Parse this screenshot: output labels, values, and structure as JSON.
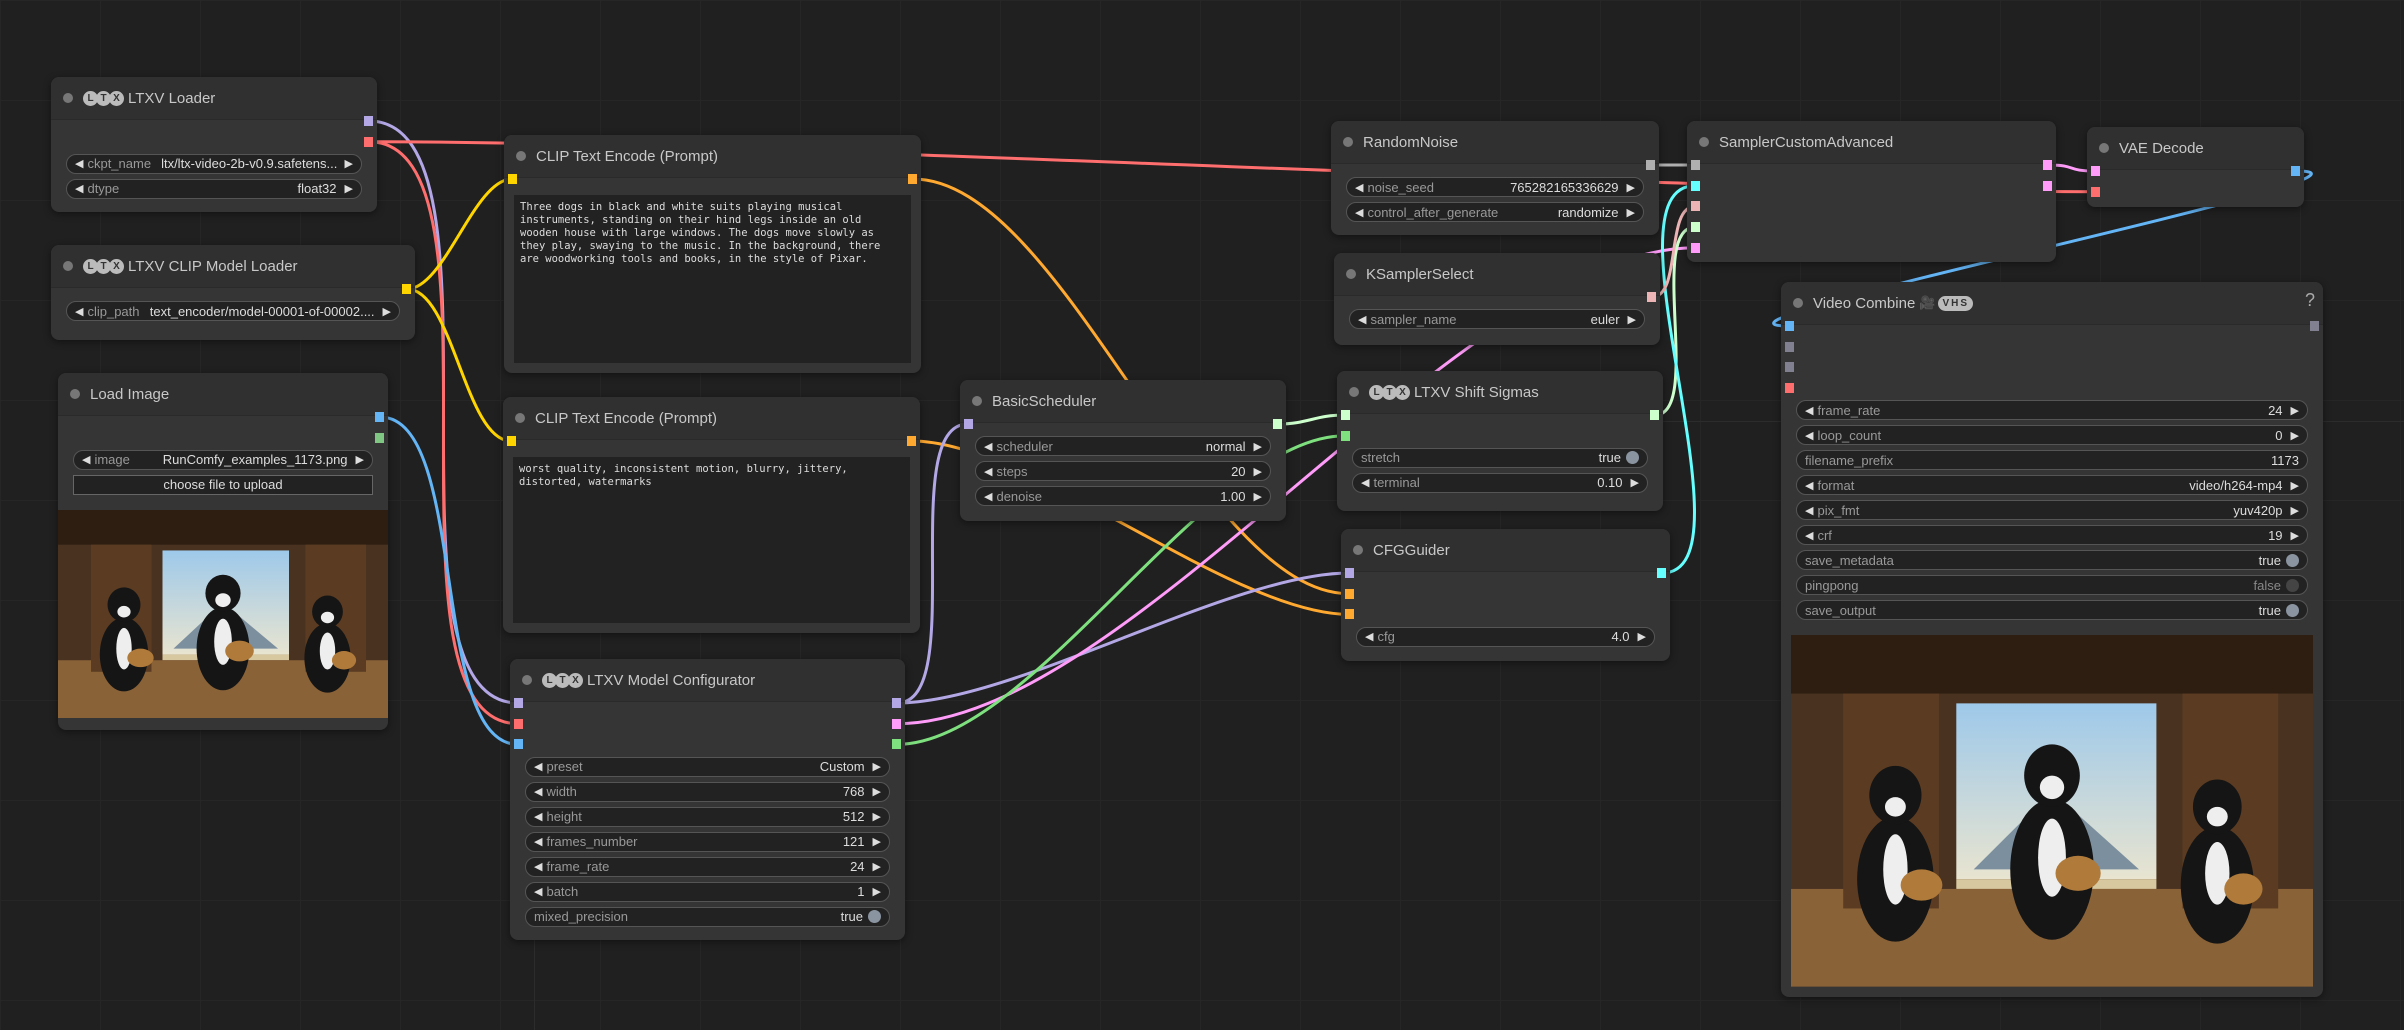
{
  "colors": {
    "model": "#b4a7e6",
    "vae": "#ff6e6e",
    "clip": "#ffd500",
    "image": "#64b5f6",
    "mask": "#81c784",
    "conditioning": "#ffa931",
    "latent": "#ff9cf9",
    "latent2": "#7ee07e",
    "sigmas": "#cdffcd",
    "noise": "#b0b0b0",
    "guider": "#66ffff",
    "sampler": "#ecb4b4",
    "grey": "#808090"
  },
  "nodes": {
    "loader": {
      "title": "LTXV Loader",
      "ltx_badge": "LTX",
      "outputs": [
        "model",
        "vae"
      ],
      "inputs": [],
      "widgets": [
        {
          "type": "combo",
          "label": "ckpt_name",
          "value": "ltx/ltx-video-2b-v0.9.safetens..."
        },
        {
          "type": "combo",
          "label": "dtype",
          "value": "float32"
        }
      ]
    },
    "clip_loader": {
      "title": "LTXV CLIP Model Loader",
      "ltx_badge": "LTX",
      "outputs": [
        "clip"
      ],
      "inputs": [],
      "widgets": [
        {
          "type": "combo",
          "label": "clip_path",
          "value": "text_encoder/model-00001-of-00002...."
        }
      ]
    },
    "load_image": {
      "title": "Load Image",
      "outputs": [
        "image",
        "mask"
      ],
      "inputs": [],
      "widgets": [
        {
          "type": "combo",
          "label": "image",
          "value": "RunComfy_examples_1173.png"
        },
        {
          "type": "button",
          "label": "choose file to upload"
        }
      ],
      "preview": true
    },
    "clip1": {
      "title": "CLIP Text Encode (Prompt)",
      "inputs": [
        "clip"
      ],
      "outputs": [
        "conditioning"
      ],
      "widgets": [],
      "text": "Three dogs in black and white suits playing musical instruments, standing on their hind legs inside an old wooden house with large windows. The dogs move slowly as they play, swaying to the music. In the background, there are woodworking tools and books, in the style of Pixar."
    },
    "clip2": {
      "title": "CLIP Text Encode (Prompt)",
      "inputs": [
        "clip"
      ],
      "outputs": [
        "conditioning"
      ],
      "widgets": [],
      "text": "worst quality, inconsistent motion, blurry, jittery, distorted, watermarks"
    },
    "configurator": {
      "title": "LTXV Model Configurator",
      "ltx_badge": "LTX",
      "inputs": [
        "model",
        "vae",
        "image"
      ],
      "outputs": [
        "model",
        "latent",
        "latent2"
      ],
      "widgets": [
        {
          "type": "combo",
          "label": "preset",
          "value": "Custom"
        },
        {
          "type": "number",
          "label": "width",
          "value": "768"
        },
        {
          "type": "number",
          "label": "height",
          "value": "512"
        },
        {
          "type": "number",
          "label": "frames_number",
          "value": "121"
        },
        {
          "type": "number",
          "label": "frame_rate",
          "value": "24"
        },
        {
          "type": "number",
          "label": "batch",
          "value": "1"
        },
        {
          "type": "toggle",
          "label": "mixed_precision",
          "value": "true"
        }
      ]
    },
    "scheduler": {
      "title": "BasicScheduler",
      "inputs": [
        "model"
      ],
      "outputs": [
        "sigmas"
      ],
      "widgets": [
        {
          "type": "combo",
          "label": "scheduler",
          "value": "normal"
        },
        {
          "type": "number",
          "label": "steps",
          "value": "20"
        },
        {
          "type": "number",
          "label": "denoise",
          "value": "1.00"
        }
      ]
    },
    "random_noise": {
      "title": "RandomNoise",
      "inputs": [],
      "outputs": [
        "noise"
      ],
      "widgets": [
        {
          "type": "number",
          "label": "noise_seed",
          "value": "765282165336629"
        },
        {
          "type": "combo",
          "label": "control_after_generate",
          "value": "randomize"
        }
      ]
    },
    "ksampler": {
      "title": "KSamplerSelect",
      "inputs": [],
      "outputs": [
        "sampler"
      ],
      "widgets": [
        {
          "type": "combo",
          "label": "sampler_name",
          "value": "euler"
        }
      ]
    },
    "shift": {
      "title": "LTXV Shift Sigmas",
      "ltx_badge": "LTX",
      "inputs": [
        "sigmas",
        "latent2"
      ],
      "outputs": [
        "sigmas"
      ],
      "widgets": [
        {
          "type": "toggle",
          "label": "stretch",
          "value": "true"
        },
        {
          "type": "number",
          "label": "terminal",
          "value": "0.10"
        }
      ]
    },
    "cfg": {
      "title": "CFGGuider",
      "inputs": [
        "model",
        "conditioning",
        "conditioning"
      ],
      "outputs": [
        "guider"
      ],
      "widgets": [
        {
          "type": "number",
          "label": "cfg",
          "value": "4.0"
        }
      ]
    },
    "sca": {
      "title": "SamplerCustomAdvanced",
      "inputs": [
        "noise",
        "guider",
        "sampler",
        "sigmas",
        "latent"
      ],
      "outputs": [
        "latent",
        "latent"
      ],
      "widgets": []
    },
    "vae": {
      "title": "VAE Decode",
      "inputs": [
        "latent",
        "vae"
      ],
      "outputs": [
        "image"
      ],
      "widgets": []
    },
    "video": {
      "title": "Video Combine",
      "vhs_badge": "VHS",
      "help": "?",
      "inputs": [
        "image",
        "grey",
        "grey",
        "vae"
      ],
      "outputs": [
        "grey"
      ],
      "preview": true,
      "widgets": [
        {
          "type": "number",
          "label": "frame_rate",
          "value": "24"
        },
        {
          "type": "number",
          "label": "loop_count",
          "value": "0"
        },
        {
          "type": "text",
          "label": "filename_prefix",
          "value": "1173"
        },
        {
          "type": "combo",
          "label": "format",
          "value": "video/h264-mp4"
        },
        {
          "type": "combo",
          "label": "pix_fmt",
          "value": "yuv420p"
        },
        {
          "type": "number",
          "label": "crf",
          "value": "19"
        },
        {
          "type": "toggle",
          "label": "save_metadata",
          "value": "true"
        },
        {
          "type": "toggle",
          "label": "pingpong",
          "value": "false"
        },
        {
          "type": "toggle",
          "label": "save_output",
          "value": "true"
        }
      ]
    }
  },
  "links": [
    {
      "from": "loader",
      "out": 0,
      "to": "configurator",
      "in": 0
    },
    {
      "from": "loader",
      "out": 1,
      "to": "configurator",
      "in": 1
    },
    {
      "from": "loader",
      "out": 1,
      "to": "vae",
      "in": 1
    },
    {
      "from": "clip_loader",
      "out": 0,
      "to": "clip1",
      "in": 0
    },
    {
      "from": "clip_loader",
      "out": 0,
      "to": "clip2",
      "in": 0
    },
    {
      "from": "load_image",
      "out": 0,
      "to": "configurator",
      "in": 2
    },
    {
      "from": "clip1",
      "out": 0,
      "to": "cfg",
      "in": 1
    },
    {
      "from": "clip2",
      "out": 0,
      "to": "cfg",
      "in": 2
    },
    {
      "from": "configurator",
      "out": 0,
      "to": "scheduler",
      "in": 0
    },
    {
      "from": "configurator",
      "out": 0,
      "to": "cfg",
      "in": 0
    },
    {
      "from": "configurator",
      "out": 1,
      "to": "sca",
      "in": 4
    },
    {
      "from": "configurator",
      "out": 2,
      "to": "shift",
      "in": 1
    },
    {
      "from": "scheduler",
      "out": 0,
      "to": "shift",
      "in": 0
    },
    {
      "from": "shift",
      "out": 0,
      "to": "sca",
      "in": 3
    },
    {
      "from": "random_noise",
      "out": 0,
      "to": "sca",
      "in": 0
    },
    {
      "from": "cfg",
      "out": 0,
      "to": "sca",
      "in": 1
    },
    {
      "from": "ksampler",
      "out": 0,
      "to": "sca",
      "in": 2
    },
    {
      "from": "sca",
      "out": 0,
      "to": "vae",
      "in": 0
    },
    {
      "from": "vae",
      "out": 0,
      "to": "video",
      "in": 0
    }
  ]
}
